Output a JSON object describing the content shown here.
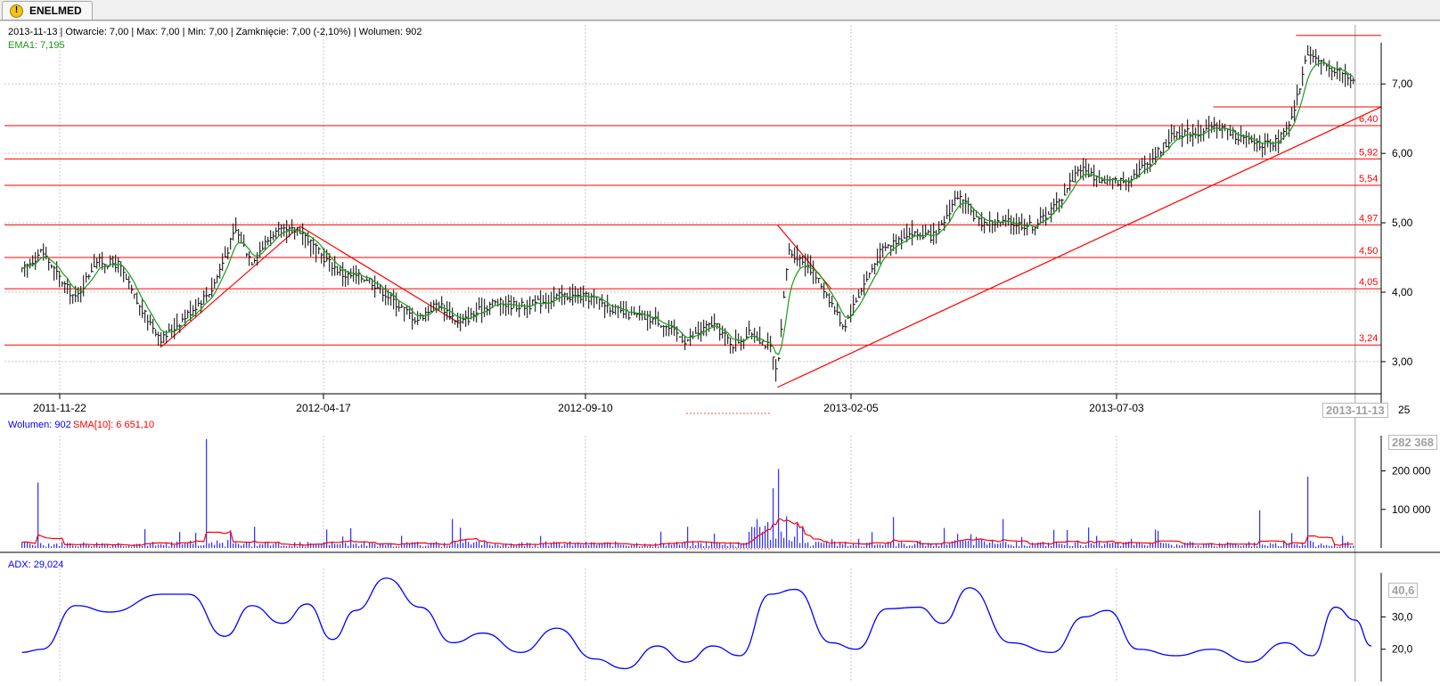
{
  "tab": {
    "label": "ENELMED",
    "icon": "warning-icon"
  },
  "colors": {
    "price_bar": "#000000",
    "ema": "#1a9a1a",
    "level": "#ff0000",
    "volume": "#0000ff",
    "volume_sma": "#ff0000",
    "adx": "#0000ff",
    "grid": "#c8c8c8"
  },
  "price_panel": {
    "info": "2013-11-13 | Otwarcie: 7,00 | Max: 7,00 | Min: 7,00 | Zamknięcie: 7,00 (-2,10%)  | Wolumen: 902",
    "ema_label": "EMA1: 7,195"
  },
  "volume_panel": {
    "volume_label": "Wolumen: 902",
    "sma_label": "SMA[10]: 6 651,10",
    "max_box": "282 368"
  },
  "adx_panel": {
    "adx_label": "ADX: 29,024",
    "max_box": "40,6"
  },
  "cursor_box": "2013-11-13",
  "x_extra_label": "25",
  "chart_data": [
    {
      "type": "ohlc",
      "xticks": [
        "2011-11-22",
        "2012-04-17",
        "2012-09-10",
        "2013-02-05",
        "2013-07-03"
      ],
      "yticks": [
        "3,00",
        "4,00",
        "5,00",
        "6,00",
        "7,00"
      ],
      "ylim": [
        2.55,
        7.85
      ],
      "levels": [
        {
          "value": 6.4,
          "label": "6,40"
        },
        {
          "value": 5.92,
          "label": "5,92"
        },
        {
          "value": 5.54,
          "label": "5,54"
        },
        {
          "value": 4.97,
          "label": "4,97"
        },
        {
          "value": 4.5,
          "label": "4,50"
        },
        {
          "value": 4.05,
          "label": "4,05"
        },
        {
          "value": 3.24,
          "label": "3,24"
        }
      ],
      "short_levels": [
        {
          "x_from": "2013-10-11",
          "x_to": "2013-12-01",
          "value": 7.7
        },
        {
          "x_from": "2013-08-26",
          "x_to": "2013-12-01",
          "value": 6.67
        }
      ],
      "trendlines": [
        {
          "from": [
            "2012-01-18",
            3.22
          ],
          "to": [
            "2012-04-04",
            4.95
          ]
        },
        {
          "from": [
            "2012-04-04",
            4.95
          ],
          "to": [
            "2012-07-02",
            3.55
          ]
        },
        {
          "from": [
            "2012-12-26",
            2.63
          ],
          "to": [
            "2013-12-01",
            6.67
          ]
        },
        {
          "from": [
            "2012-12-26",
            4.97
          ],
          "to": [
            "2013-01-25",
            4.05
          ]
        }
      ],
      "close_path": [
        [
          "2011-11-01",
          4.3
        ],
        [
          "2011-11-12",
          4.6
        ],
        [
          "2011-11-22",
          4.2
        ],
        [
          "2011-12-01",
          3.9
        ],
        [
          "2011-12-12",
          4.45
        ],
        [
          "2011-12-25",
          4.4
        ],
        [
          "2012-01-05",
          3.8
        ],
        [
          "2012-01-18",
          3.32
        ],
        [
          "2012-02-02",
          3.7
        ],
        [
          "2012-02-15",
          4.05
        ],
        [
          "2012-02-28",
          4.9
        ],
        [
          "2012-03-08",
          4.45
        ],
        [
          "2012-03-20",
          4.85
        ],
        [
          "2012-04-04",
          4.9
        ],
        [
          "2012-04-15",
          4.55
        ],
        [
          "2012-04-28",
          4.25
        ],
        [
          "2012-05-12",
          4.2
        ],
        [
          "2012-05-25",
          3.9
        ],
        [
          "2012-06-08",
          3.6
        ],
        [
          "2012-06-20",
          3.85
        ],
        [
          "2012-07-02",
          3.55
        ],
        [
          "2012-07-20",
          3.85
        ],
        [
          "2012-08-08",
          3.8
        ],
        [
          "2012-08-28",
          3.95
        ],
        [
          "2012-09-14",
          3.92
        ],
        [
          "2012-09-30",
          3.7
        ],
        [
          "2012-10-20",
          3.6
        ],
        [
          "2012-11-05",
          3.3
        ],
        [
          "2012-11-20",
          3.55
        ],
        [
          "2012-12-01",
          3.25
        ],
        [
          "2012-12-12",
          3.42
        ],
        [
          "2012-12-22",
          3.2
        ],
        [
          "2012-12-26",
          2.8
        ],
        [
          "2013-01-01",
          4.6
        ],
        [
          "2013-01-12",
          4.4
        ],
        [
          "2013-01-22",
          4.0
        ],
        [
          "2013-02-01",
          3.5
        ],
        [
          "2013-02-10",
          4.0
        ],
        [
          "2013-02-22",
          4.6
        ],
        [
          "2013-03-08",
          4.85
        ],
        [
          "2013-03-25",
          4.8
        ],
        [
          "2013-04-05",
          5.4
        ],
        [
          "2013-04-18",
          5.0
        ],
        [
          "2013-05-05",
          5.0
        ],
        [
          "2013-05-18",
          4.95
        ],
        [
          "2013-06-01",
          5.3
        ],
        [
          "2013-06-12",
          5.8
        ],
        [
          "2013-06-25",
          5.6
        ],
        [
          "2013-07-08",
          5.6
        ],
        [
          "2013-07-22",
          5.9
        ],
        [
          "2013-08-05",
          6.3
        ],
        [
          "2013-08-20",
          6.3
        ],
        [
          "2013-08-28",
          6.4
        ],
        [
          "2013-09-12",
          6.2
        ],
        [
          "2013-09-28",
          6.1
        ],
        [
          "2013-10-08",
          6.4
        ],
        [
          "2013-10-18",
          7.5
        ],
        [
          "2013-10-26",
          7.25
        ],
        [
          "2013-11-04",
          7.2
        ],
        [
          "2013-11-13",
          7.0
        ]
      ],
      "ema_value": 7.195
    },
    {
      "type": "bar",
      "series": "volume",
      "yticks": [
        "100 000",
        "200 000"
      ],
      "ylim": [
        0,
        282368
      ],
      "spikes": [
        {
          "x": "2011-11-09",
          "value": 170000
        },
        {
          "x": "2012-02-12",
          "value": 282368
        },
        {
          "x": "2012-03-10",
          "value": 55000
        },
        {
          "x": "2012-06-28",
          "value": 75000
        },
        {
          "x": "2012-11-05",
          "value": 55000
        },
        {
          "x": "2012-12-26",
          "value": 205000
        },
        {
          "x": "2012-12-23",
          "value": 155000
        },
        {
          "x": "2013-03-01",
          "value": 80000
        },
        {
          "x": "2013-05-01",
          "value": 75000
        },
        {
          "x": "2013-09-20",
          "value": 98000
        },
        {
          "x": "2013-10-17",
          "value": 185000
        }
      ]
    },
    {
      "type": "line",
      "series": "ADX",
      "yticks": [
        "20,0",
        "30,0"
      ],
      "ylim": [
        10,
        45
      ],
      "values": [
        [
          "2011-11-01",
          19.0
        ],
        [
          "2011-11-12",
          20.0
        ],
        [
          "2011-12-01",
          33.5
        ],
        [
          "2011-12-20",
          31.5
        ],
        [
          "2012-01-18",
          37.0
        ],
        [
          "2012-02-02",
          37.0
        ],
        [
          "2012-02-22",
          24.0
        ],
        [
          "2012-03-08",
          33.5
        ],
        [
          "2012-03-25",
          28.0
        ],
        [
          "2012-04-08",
          34.0
        ],
        [
          "2012-04-22",
          23.0
        ],
        [
          "2012-05-05",
          32.0
        ],
        [
          "2012-05-22",
          42.0
        ],
        [
          "2012-06-10",
          33.0
        ],
        [
          "2012-06-28",
          22.0
        ],
        [
          "2012-07-15",
          25.0
        ],
        [
          "2012-08-05",
          19.0
        ],
        [
          "2012-08-25",
          26.5
        ],
        [
          "2012-09-15",
          17.0
        ],
        [
          "2012-10-02",
          14.0
        ],
        [
          "2012-10-20",
          21.0
        ],
        [
          "2012-11-05",
          16.0
        ],
        [
          "2012-11-20",
          21.0
        ],
        [
          "2012-12-05",
          18.0
        ],
        [
          "2012-12-22",
          37.0
        ],
        [
          "2013-01-05",
          38.5
        ],
        [
          "2013-01-25",
          22.0
        ],
        [
          "2013-02-08",
          20.0
        ],
        [
          "2013-02-25",
          32.5
        ],
        [
          "2013-03-15",
          33.0
        ],
        [
          "2013-03-28",
          28.0
        ],
        [
          "2013-04-12",
          39.0
        ],
        [
          "2013-05-05",
          22.0
        ],
        [
          "2013-05-28",
          19.0
        ],
        [
          "2013-06-15",
          30.0
        ],
        [
          "2013-06-28",
          32.0
        ],
        [
          "2013-07-15",
          20.0
        ],
        [
          "2013-08-05",
          18.0
        ],
        [
          "2013-08-25",
          20.0
        ],
        [
          "2013-09-15",
          16.0
        ],
        [
          "2013-10-05",
          22.0
        ],
        [
          "2013-10-20",
          18.0
        ],
        [
          "2013-11-02",
          33.0
        ],
        [
          "2013-11-13",
          29.0
        ],
        [
          "2013-11-22",
          21.0
        ]
      ]
    }
  ]
}
